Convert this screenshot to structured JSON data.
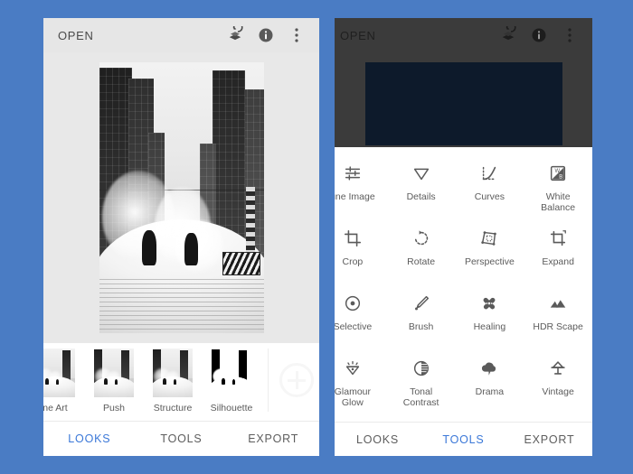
{
  "background_color": "#4a7cc4",
  "accent_color": "#3b78d8",
  "left_panel": {
    "topbar": {
      "open_label": "OPEN",
      "icons": [
        "layers-undo-icon",
        "info-icon",
        "overflow-menu-icon"
      ]
    },
    "photo": {
      "description": "black and white city street with steam and snow"
    },
    "looks": [
      {
        "label": "ne Art"
      },
      {
        "label": "Push"
      },
      {
        "label": "Structure"
      },
      {
        "label": "Silhouette"
      }
    ],
    "add_look_icon": "add-look-icon",
    "tabs": [
      {
        "label": "LOOKS",
        "active": true
      },
      {
        "label": "TOOLS",
        "active": false
      },
      {
        "label": "EXPORT",
        "active": false
      }
    ]
  },
  "right_panel": {
    "topbar": {
      "open_label": "OPEN",
      "icons": [
        "layers-undo-icon",
        "info-icon",
        "overflow-menu-icon"
      ]
    },
    "tools": [
      {
        "label": "une Image",
        "icon": "tune-image-icon"
      },
      {
        "label": "Details",
        "icon": "details-icon"
      },
      {
        "label": "Curves",
        "icon": "curves-icon"
      },
      {
        "label": "White\nBalance",
        "icon": "white-balance-icon"
      },
      {
        "label": "Crop",
        "icon": "crop-icon"
      },
      {
        "label": "Rotate",
        "icon": "rotate-icon"
      },
      {
        "label": "Perspective",
        "icon": "perspective-icon"
      },
      {
        "label": "Expand",
        "icon": "expand-icon"
      },
      {
        "label": "Selective",
        "icon": "selective-icon"
      },
      {
        "label": "Brush",
        "icon": "brush-icon"
      },
      {
        "label": "Healing",
        "icon": "healing-icon"
      },
      {
        "label": "HDR Scape",
        "icon": "hdr-scape-icon"
      },
      {
        "label": "Glamour\nGlow",
        "icon": "glamour-glow-icon"
      },
      {
        "label": "Tonal\nContrast",
        "icon": "tonal-contrast-icon"
      },
      {
        "label": "Drama",
        "icon": "drama-icon"
      },
      {
        "label": "Vintage",
        "icon": "vintage-icon"
      },
      {
        "label": "",
        "icon": "grainy-film-icon"
      },
      {
        "label": "",
        "icon": "retrolux-icon"
      },
      {
        "label": "",
        "icon": "grunge-icon"
      },
      {
        "label": "",
        "icon": "frames-icon"
      }
    ],
    "tabs": [
      {
        "label": "LOOKS",
        "active": false
      },
      {
        "label": "TOOLS",
        "active": true
      },
      {
        "label": "EXPORT",
        "active": false
      }
    ]
  }
}
